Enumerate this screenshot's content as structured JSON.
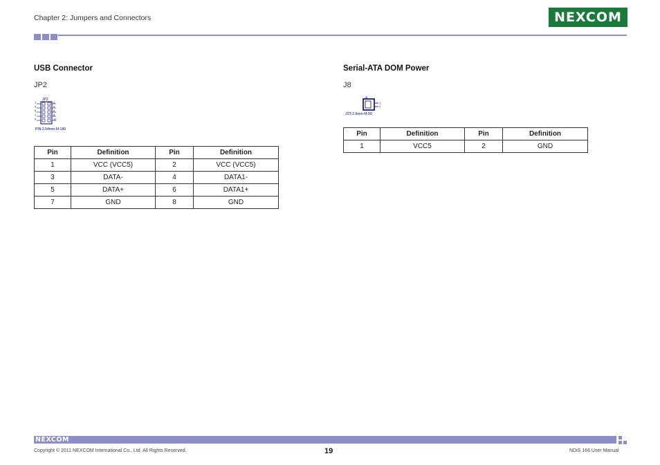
{
  "header": {
    "chapter": "Chapter 2: Jumpers and Connectors",
    "logo_text": "NEXCOM",
    "accent_color": "#8b8fc6",
    "logo_color": "#1a7a3c"
  },
  "usb": {
    "title": "USB Connector",
    "ref": "JP2",
    "diagram": {
      "designator": "JP2",
      "part": "PIN-2.54mm-M-180",
      "left_pins": [
        "1",
        "3",
        "5",
        "7",
        "9"
      ],
      "right_pins": [
        "2",
        "4",
        "6",
        "8",
        "10"
      ]
    },
    "table": {
      "headers": [
        "Pin",
        "Definition",
        "Pin",
        "Definition"
      ],
      "rows": [
        [
          "1",
          "VCC (VCC5)",
          "2",
          "VCC (VCC5)"
        ],
        [
          "3",
          "DATA-",
          "4",
          "DATA1-"
        ],
        [
          "5",
          "DATA+",
          "6",
          "DATA1+"
        ],
        [
          "7",
          "GND",
          "8",
          "GND"
        ]
      ]
    }
  },
  "sata": {
    "title": "Serial-ATA DOM Power",
    "ref": "J8",
    "diagram": {
      "designator": "J8",
      "part": "JST-2.5mm-M-90",
      "pins": [
        "1",
        "2"
      ]
    },
    "table": {
      "headers": [
        "Pin",
        "Definition",
        "Pin",
        "Definition"
      ],
      "rows": [
        [
          "1",
          "VCC5",
          "2",
          "GND"
        ]
      ]
    }
  },
  "footer": {
    "logo_text": "NEXCOM",
    "copyright": "Copyright © 2011 NEXCOM International Co., Ltd. All Rights Reserved.",
    "page_number": "19",
    "manual": "NDiS 166 User Manual"
  }
}
